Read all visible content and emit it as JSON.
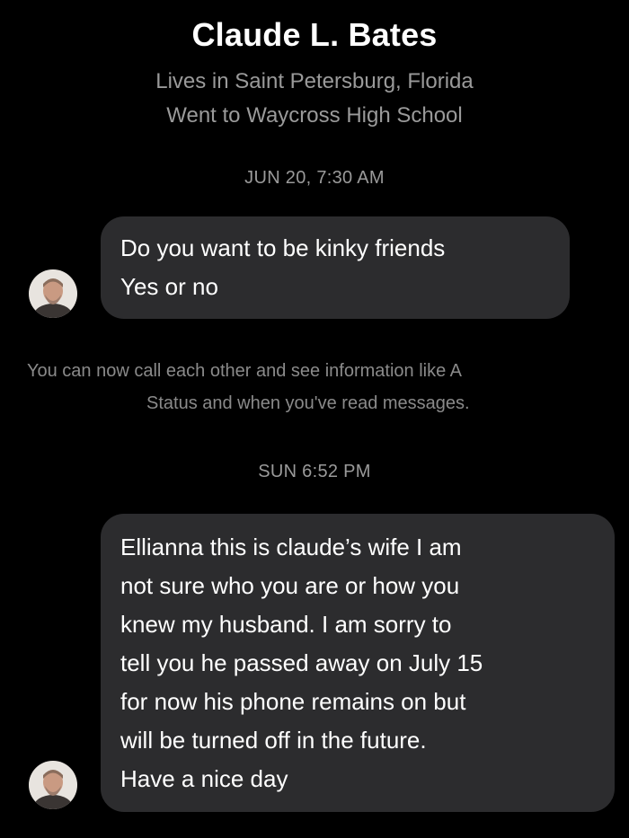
{
  "header": {
    "name": "Claude L. Bates",
    "lives_in": "Lives in Saint Petersburg, Florida",
    "school": "Went to Waycross High School"
  },
  "thread": {
    "timestamp_1": "JUN 20, 7:30 AM",
    "message_1": {
      "line_1": "Do you want to be kinky friends",
      "line_2": "Yes or no"
    },
    "system_notice": {
      "line_1": "You can now call each other and see information like A",
      "line_2": "Status and when you've read messages."
    },
    "timestamp_2": "SUN 6:52 PM",
    "message_2": {
      "lines": [
        "Ellianna this is claude’s wife I am",
        "not sure who you are or how you",
        "knew my husband.  I am sorry to",
        "tell you he passed away on July 15",
        "for now his phone remains on but",
        "will be turned off in the future.",
        "Have a nice day"
      ]
    }
  },
  "avatar_icon": "contact-photo-icon",
  "colors": {
    "background": "#000000",
    "bubble": "#2c2c2e",
    "primary_text": "#ffffff",
    "secondary_text": "#9a9a9a"
  }
}
